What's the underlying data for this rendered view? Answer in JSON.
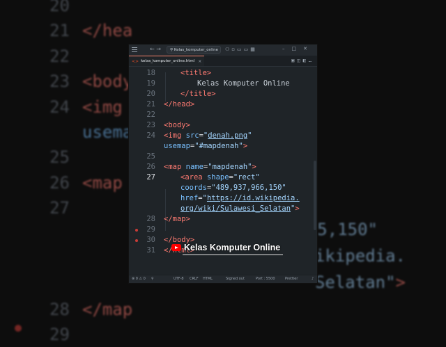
{
  "window": {
    "search_text": "Kelas_komputer_online",
    "tab": {
      "label": "kelas_komputer_online.html",
      "close": "×"
    }
  },
  "code_lines": [
    {
      "num": "18",
      "html": "<span class=\"tag\">&lt;title&gt;</span>",
      "indent": 1
    },
    {
      "num": "19",
      "html": "<span class=\"txt\">Kelas Komputer Online</span>",
      "indent": 2
    },
    {
      "num": "20",
      "html": "<span class=\"tag\">&lt;/title&gt;</span>",
      "indent": 1
    },
    {
      "num": "21",
      "html": "<span class=\"tag\">&lt;/head&gt;</span>",
      "indent": 0
    },
    {
      "num": "22",
      "html": "",
      "indent": 0
    },
    {
      "num": "23",
      "html": "<span class=\"tag\">&lt;body&gt;</span>",
      "indent": 0
    },
    {
      "num": "24",
      "html": "<span class=\"tag\">&lt;img</span> <span class=\"attr\">src</span>=<span class=\"str\">\"<u>denah.png</u>\"</span>",
      "indent": 0
    },
    {
      "num": "",
      "html": "<span class=\"attr\">usemap</span>=<span class=\"str\">\"#mapdenah\"</span><span class=\"tag\">&gt;</span>",
      "indent": 0
    },
    {
      "num": "25",
      "html": "",
      "indent": 0
    },
    {
      "num": "26",
      "html": "<span class=\"tag\">&lt;map</span> <span class=\"attr\">name</span>=<span class=\"str\">\"mapdenah\"</span><span class=\"tag\">&gt;</span>",
      "indent": 0
    },
    {
      "num": "27",
      "html": "<span class=\"tag\">&lt;area</span> <span class=\"attr\">shape</span>=<span class=\"str\">\"rect\"</span>",
      "indent": 1,
      "current": true
    },
    {
      "num": "",
      "html": "<span class=\"attr\">coords</span>=<span class=\"str\">\"489,937,966,150\"</span>",
      "indent": 1
    },
    {
      "num": "",
      "html": "<span class=\"attr\">href</span>=<span class=\"str\">\"<u>https://id.wikipedia.</u></span>",
      "indent": 1
    },
    {
      "num": "",
      "html": "<span class=\"str\"><u>org/wiki/Sulawesi_Selatan</u>\"</span><span class=\"tag\">&gt;</span>",
      "indent": 1
    },
    {
      "num": "28",
      "html": "<span class=\"tag\">&lt;/map&gt;</span>",
      "indent": 0
    },
    {
      "num": "29",
      "html": "",
      "indent": 0,
      "breakpoint": true
    },
    {
      "num": "30",
      "html": "<span class=\"tag\">&lt;/body&gt;</span>",
      "indent": 0,
      "breakpoint": true
    },
    {
      "num": "31",
      "html": "<span class=\"tag\">&lt;/html&gt;</span>",
      "indent": 0
    }
  ],
  "status_bar": {
    "problems": "⊗ 0 ⚠ 0",
    "encoding": "UTF-8",
    "eol": "CRLF",
    "language": "HTML",
    "account": "Signed out",
    "port": "Port : 5500",
    "formatter": "Prettier"
  },
  "watermark": {
    "text": "Kelas Komputer Online"
  },
  "background": {
    "left_lines": [
      {
        "num": "20",
        "html": ""
      },
      {
        "num": "21",
        "html": "<span class=\"tag\">&lt;/hea</span>"
      },
      {
        "num": "22",
        "html": ""
      },
      {
        "num": "23",
        "html": "<span class=\"tag\">&lt;body</span>"
      },
      {
        "num": "24",
        "html": "<span class=\"tag\">&lt;img</span>"
      },
      {
        "num": "",
        "html": "<span class=\"attr\">usema</span>"
      },
      {
        "num": "25",
        "html": ""
      },
      {
        "num": "26",
        "html": "<span class=\"tag\">&lt;map</span>"
      },
      {
        "num": "27",
        "html": ""
      },
      {
        "num": "",
        "html": ""
      },
      {
        "num": "",
        "html": ""
      },
      {
        "num": "",
        "html": ""
      },
      {
        "num": "28",
        "html": "<span class=\"tag\">&lt;/map</span>"
      },
      {
        "num": "29",
        "html": ""
      }
    ],
    "right_lines": [
      {
        "html": "<span class=\"str\">5,150\"</span>"
      },
      {
        "html": "<span class=\"str\">ikipedia.</span>"
      },
      {
        "html": "<span class=\"str\">Selatan\"</span><span class=\"tag\">&gt;</span>"
      }
    ]
  }
}
